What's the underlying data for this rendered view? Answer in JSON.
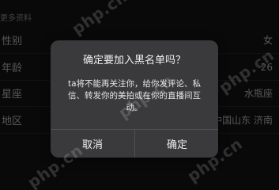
{
  "background": {
    "section_label": "更多资料",
    "rows": [
      {
        "label": "性别",
        "value": "女"
      },
      {
        "label": "年龄",
        "value": "26"
      },
      {
        "label": "星座",
        "value": "水瓶座"
      },
      {
        "label": "地区",
        "value": "中国山东 济南"
      }
    ]
  },
  "dialog": {
    "title": "确定要加入黑名单吗？",
    "message": "ta将不能再关注你，给你发评论、私信、转发你的美拍或在你的直播间互动。",
    "cancel_label": "取消",
    "confirm_label": "确定"
  },
  "watermark": {
    "text": "php.cn"
  },
  "colors": {
    "background": "#111111",
    "dialog": "#3a3a3c",
    "divider": "#505054"
  }
}
